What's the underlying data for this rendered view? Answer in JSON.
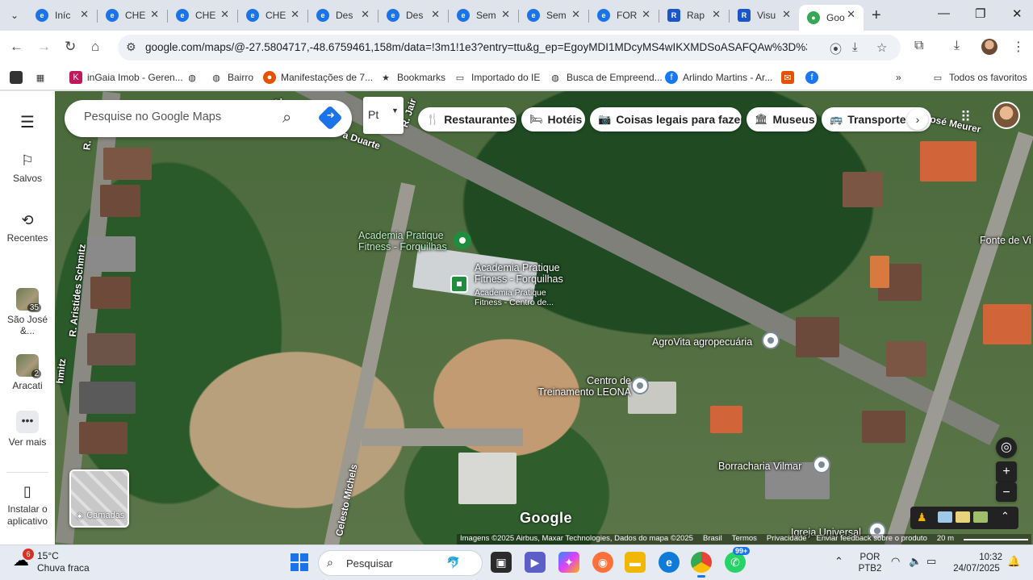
{
  "browser": {
    "tabs": [
      {
        "label": "Iníc",
        "color": "#1a73e8"
      },
      {
        "label": "CHE",
        "color": "#1a73e8"
      },
      {
        "label": "CHE",
        "color": "#1a73e8"
      },
      {
        "label": "CHE",
        "color": "#1a73e8"
      },
      {
        "label": "Des",
        "color": "#1a73e8"
      },
      {
        "label": "Des",
        "color": "#1a73e8"
      },
      {
        "label": "Sem",
        "color": "#1a73e8"
      },
      {
        "label": "Sem",
        "color": "#1a73e8"
      },
      {
        "label": "FOR",
        "color": "#1a73e8"
      },
      {
        "label": "Rap",
        "color": "#1a56c9"
      },
      {
        "label": "Visu",
        "color": "#1a56c9"
      },
      {
        "label": "Goo",
        "color": "#34a853"
      }
    ],
    "url": "google.com/maps/@-27.5804717,-48.6759461,158m/data=!3m1!1e3?entry=ttu&g_ep=EgoyMDI1MDcyMS4wIKXMDSoASAFQAw%3D%3D",
    "bookmarks": [
      {
        "label": "inGaia Imob - Geren..."
      },
      {
        "label": ""
      },
      {
        "label": "Bairro"
      },
      {
        "label": "Manifestações de 7..."
      },
      {
        "label": "Bookmarks"
      },
      {
        "label": "Importado do IE"
      },
      {
        "label": "Busca de Empreend..."
      },
      {
        "label": "Arlindo Martins - Ar..."
      }
    ],
    "all_favorites": "Todos os favoritos"
  },
  "rail": {
    "saved": "Salvos",
    "recents": "Recentes",
    "recent1": {
      "label": "São José &...",
      "num": "35"
    },
    "recent2": {
      "label": "Aracati",
      "num": "2"
    },
    "more": "Ver mais",
    "install": "Instalar o aplicativo"
  },
  "search": {
    "placeholder": "Pesquise no Google Maps"
  },
  "pt_chip": "Pt",
  "chips": [
    {
      "label": "Restaurantes",
      "icon": "🍴"
    },
    {
      "label": "Hotéis",
      "icon": "🛏"
    },
    {
      "label": "Coisas legais para fazer",
      "icon": "📷"
    },
    {
      "label": "Museus",
      "icon": "🏛"
    },
    {
      "label": "Transporte p",
      "icon": "🚌"
    }
  ],
  "map": {
    "roads": {
      "duarte": "a Duarte",
      "jair": "R. Jair",
      "aristides": "R. Aristides Schmitz",
      "r_left": "R.",
      "r_left2": "R.",
      "jose_meurer": "osé Meurer",
      "celesto": "Celesto Michels",
      "schmitz_bottom": "hmitz"
    },
    "pois": {
      "academia1": "Academia Pratique Fitness - Forquilhas",
      "academia2": "Academia Pratique Fitness - Forquilhas",
      "academia3": "Academia Pratique Fitness - Centro de...",
      "agrovita": "AgroVita agropecuária",
      "leona": "Centro de Treinamento LEONA",
      "borracharia": "Borracharia Vilmar",
      "fonte": "Fonte de Vi",
      "igreja": "Igreja Universal"
    },
    "layers_label": "Camadas",
    "google": "Google",
    "attribution": {
      "imagery": "Imagens ©2025 Airbus, Maxar Technologies, Dados do mapa ©2025",
      "brasil": "Brasil",
      "terms": "Termos",
      "privacy": "Privacidade",
      "feedback": "Enviar feedback sobre o produto",
      "scale": "20 m"
    }
  },
  "taskbar": {
    "temp": "15°C",
    "weather": "Chuva fraca",
    "weather_badge": "6",
    "search_placeholder": "Pesquisar",
    "lang1": "POR",
    "lang2": "PTB2",
    "time": "10:32",
    "date": "24/07/2025",
    "whatsapp_badge": "99+"
  }
}
